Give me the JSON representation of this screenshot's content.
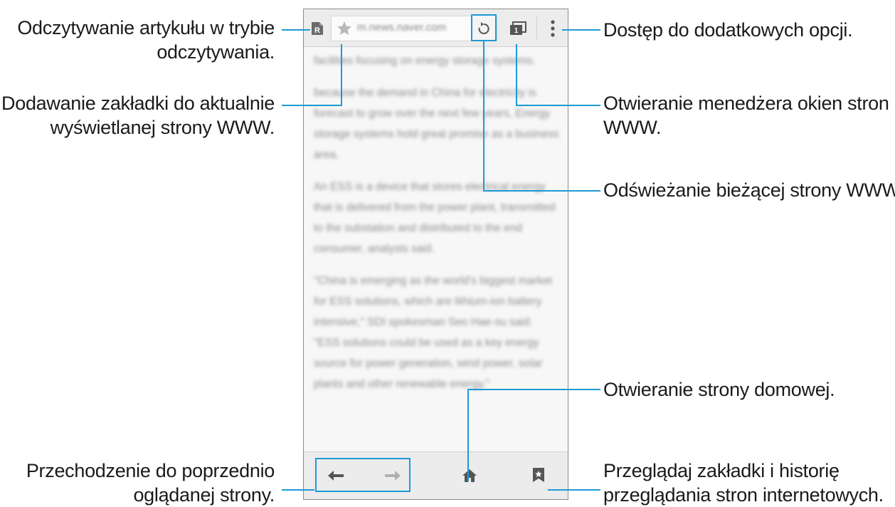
{
  "callouts": {
    "reader_mode": [
      "Odczytywanie artykułu w trybie",
      "odczytywania."
    ],
    "add_bookmark": [
      "Dodawanie zakładki do aktualnie",
      "wyświetlanej strony WWW."
    ],
    "back": [
      "Przechodzenie do poprzednio",
      "oglądanej strony."
    ],
    "more_options": [
      "Dostęp do dodatkowych opcji."
    ],
    "window_manager": [
      "Otwieranie menedżera okien stron",
      "WWW."
    ],
    "refresh": [
      "Odświeżanie bieżącej strony WWW."
    ],
    "home": [
      "Otwieranie strony domowej."
    ],
    "bookmarks_history": [
      "Przeglądaj zakładki i historię",
      "przeglądania stron internetowych."
    ]
  },
  "browser": {
    "url": "m.news.naver.com",
    "reader_badge": "R",
    "tab_count": "1",
    "article_paragraphs": [
      "facilities focusing on energy storage systems.",
      "because the demand in China for electricity is forecast to grow over the next few years, Energy storage systems hold great promise as a business area.",
      "An ESS is a device that stores electrical energy that is delivered from the power plant, transmitted to the substation and distributed to the end consumer, analysts said.",
      "\"China is emerging as the world's biggest market for ESS solutions, which are lithium-ion battery intensive,\" SDI spokesman Seo Hae-su said. \"ESS solutions could be used as a key energy source for power generation, wind power, solar plants and other renewable energy.\""
    ]
  },
  "colors": {
    "highlight": "#1d9ad6",
    "icon": "#555555",
    "star": "#b9b9b9"
  }
}
